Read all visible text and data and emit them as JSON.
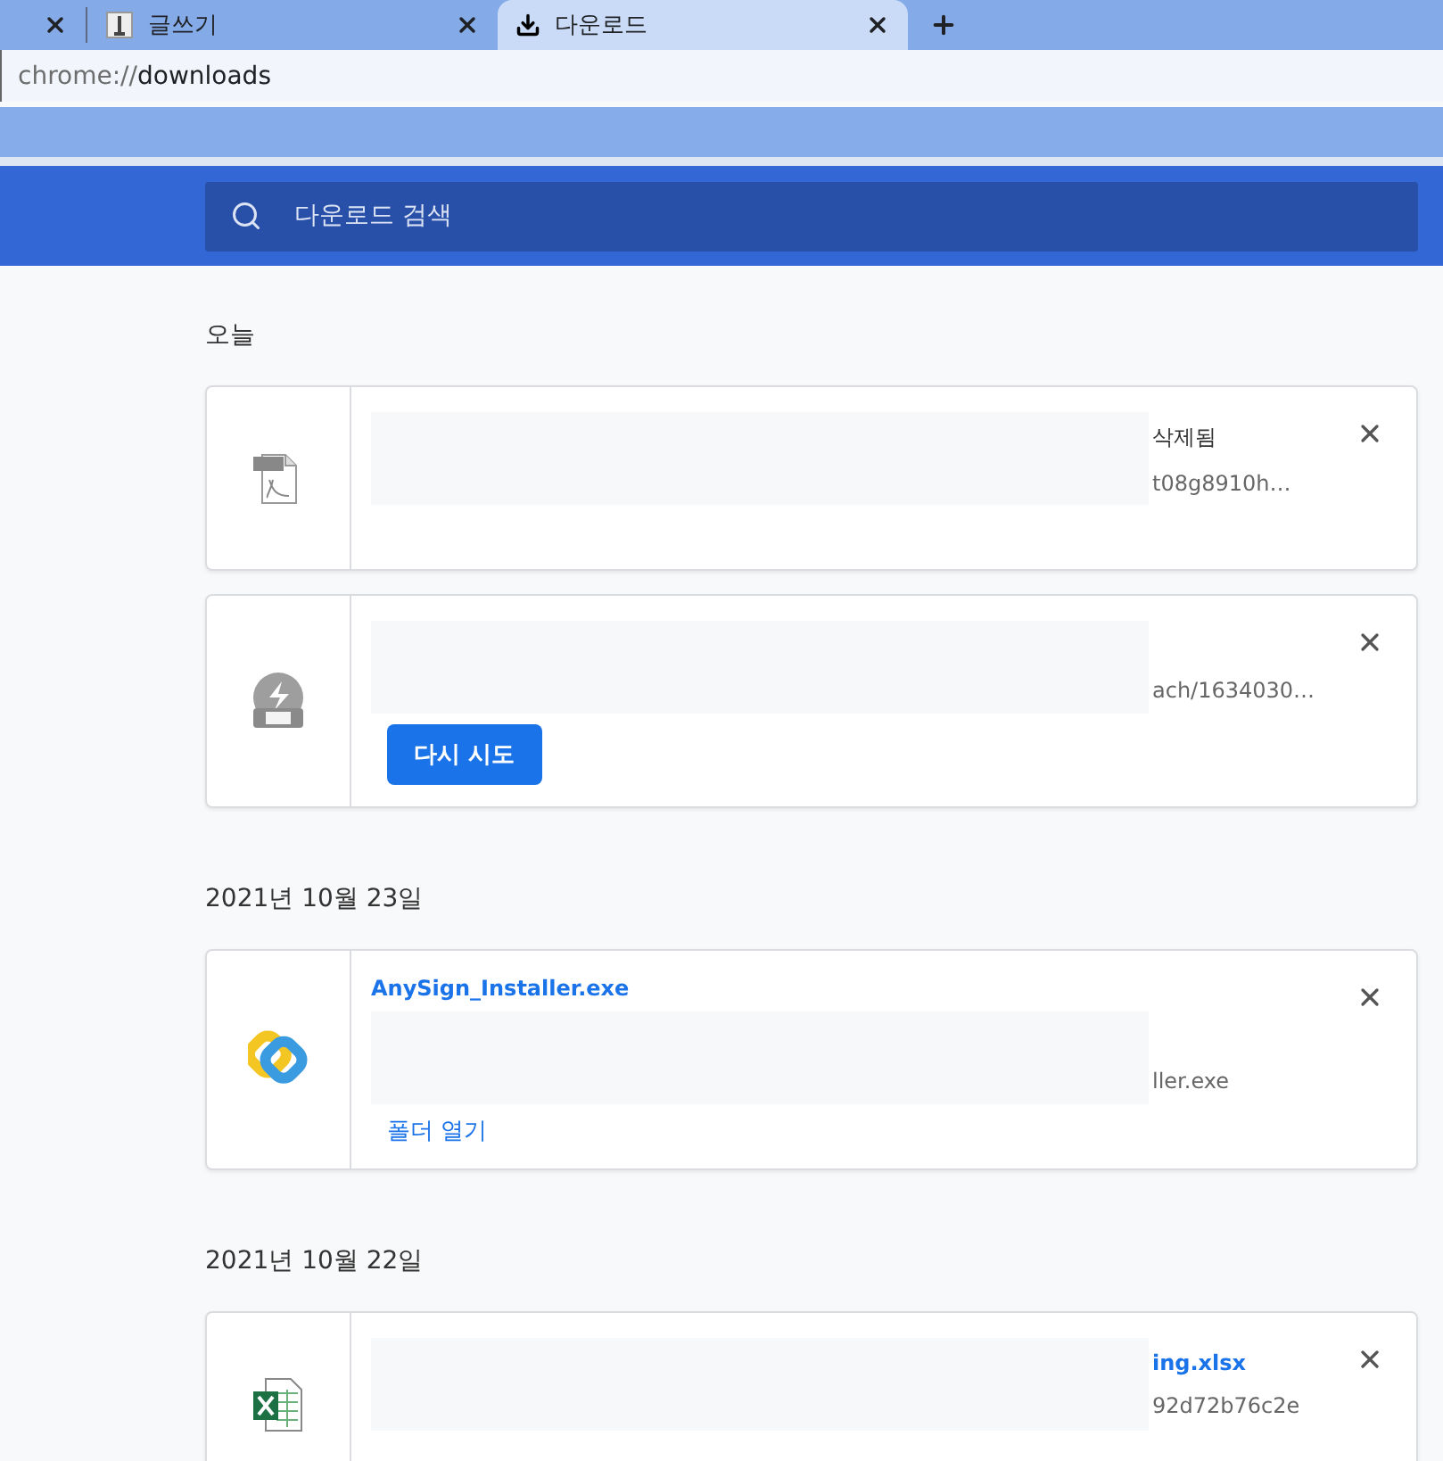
{
  "tabs": [
    {
      "kind": "partial",
      "selected": false
    },
    {
      "kind": "page",
      "label": "글쓰기",
      "selected": false
    },
    {
      "kind": "download",
      "label": "다운로드",
      "selected": true
    }
  ],
  "address": {
    "scheme": "chrome://",
    "path": "downloads"
  },
  "search": {
    "placeholder": "다운로드 검색"
  },
  "groups": [
    {
      "date": "오늘",
      "items": [
        {
          "kind": "pdf",
          "status": "삭제됨",
          "url": "t08g8910h…"
        },
        {
          "kind": "zip",
          "url": "ach/1634030…",
          "button": "다시 시도"
        }
      ]
    },
    {
      "date": "2021년 10월 23일",
      "items": [
        {
          "kind": "ring",
          "name": "AnySign_Installer.exe",
          "url": "ller.exe",
          "link": "폴더 열기"
        }
      ]
    },
    {
      "date": "2021년 10월 22일",
      "items": [
        {
          "kind": "excel",
          "name": "ing.xlsx",
          "url": "92d72b76c2e"
        }
      ]
    }
  ]
}
